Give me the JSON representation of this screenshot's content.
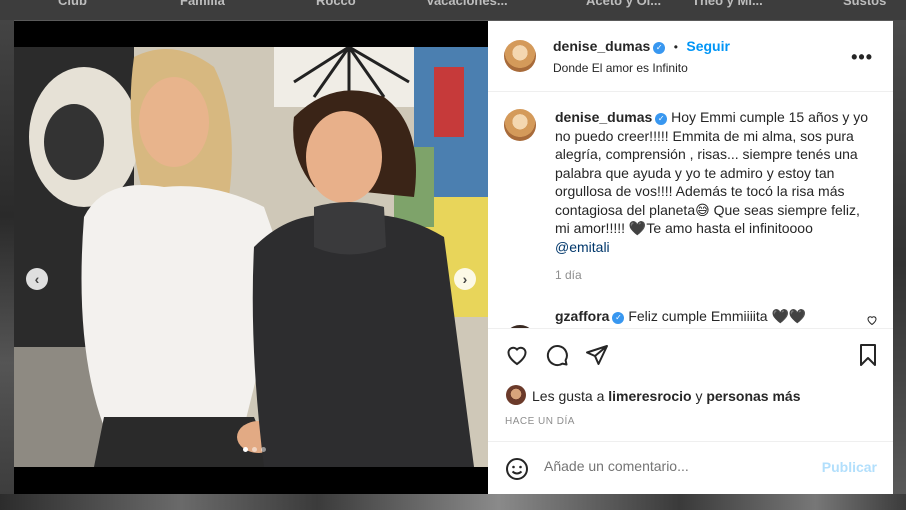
{
  "background_nav": [
    "Club",
    "Familia",
    "Rocco",
    "Vacaciones...",
    "Aceto y Ol...",
    "Theo y Mi...",
    "Sustos"
  ],
  "post": {
    "username": "denise_dumas",
    "follow_label": "Seguir",
    "location": "Donde El amor es Infinito",
    "more_label": "•••",
    "caption_text": "Hoy Emmi cumple 15 años y yo no puedo creer!!!!! Emmita de mi alma, sos pura alegría, comprensión , risas... siempre tenés una palabra que ayuda y yo te admiro y estoy tan orgullosa de vos!!!! Además te tocó la risa más contagiosa del planeta😅 Que seas siempre feliz, mi amor!!!!! 🖤Te amo hasta el infinitoooo",
    "caption_mention": "@emitali",
    "caption_time": "1 día",
    "comments": [
      {
        "username": "gzaffora",
        "text": "Feliz cumple Emmiiiita 🖤🖤"
      }
    ],
    "likes_prefix": "Les gusta a",
    "likes_user": "limeresrocio",
    "likes_joiner": "y",
    "likes_suffix": "personas más",
    "posted_ago": "HACE UN DÍA",
    "comment_placeholder": "Añade un comentario...",
    "publish_label": "Publicar",
    "carousel": {
      "total": 3,
      "current": 1
    }
  },
  "colors": {
    "accent": "#0095f6",
    "verified": "#3897f0",
    "publish_disabled": "#b2dffc"
  },
  "icons": [
    "verified-badge-icon",
    "heart-icon",
    "comment-icon",
    "share-icon",
    "bookmark-icon",
    "emoji-icon",
    "chevron-left-icon",
    "chevron-right-icon",
    "more-icon"
  ]
}
